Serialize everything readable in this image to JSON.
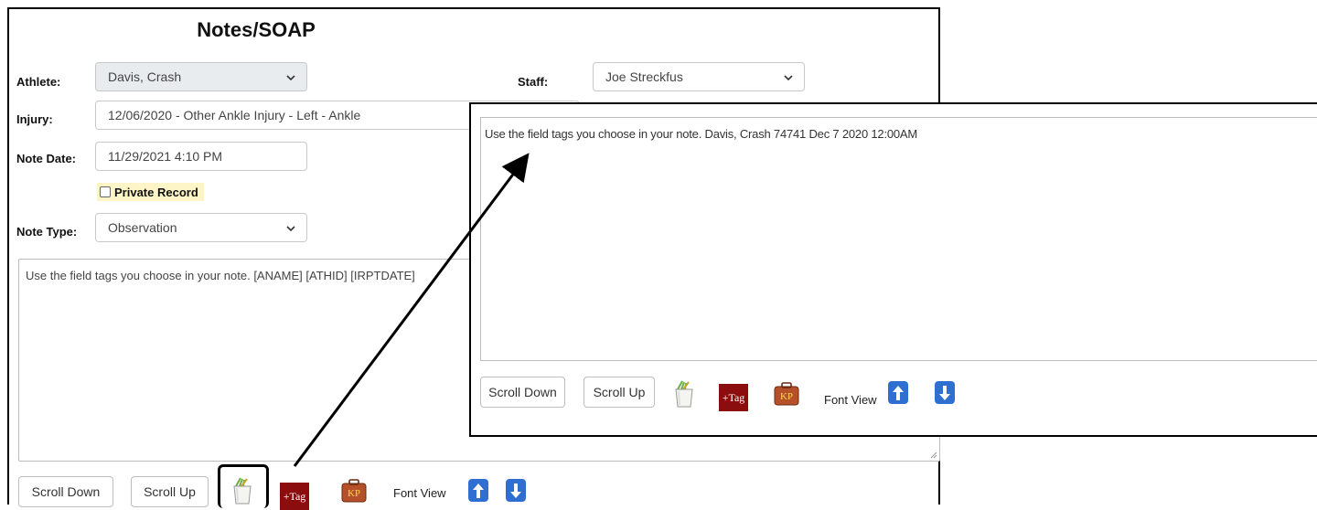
{
  "form": {
    "title": "Notes/SOAP",
    "athlete": {
      "label": "Athlete:",
      "value": "Davis, Crash"
    },
    "staff": {
      "label": "Staff:",
      "value": "Joe Streckfus"
    },
    "injury": {
      "label": "Injury:",
      "value": "12/06/2020 - Other Ankle Injury - Left - Ankle"
    },
    "note_date": {
      "label": "Note Date:",
      "value": "11/29/2021 4:10 PM"
    },
    "private_record": {
      "label": "Private Record",
      "checked": false
    },
    "note_type": {
      "label": "Note Type:",
      "value": "Observation"
    },
    "note_text": "Use the field tags you choose in your note.   [ANAME] [ATHID] [IRPTDATE]"
  },
  "toolbar": {
    "scroll_down": "Scroll Down",
    "scroll_up": "Scroll Up",
    "tag_label": "+Tag",
    "kp_icon": "KP",
    "font_view": "Font View"
  },
  "zoom": {
    "note_text": "Use the field tags you choose in your note.   Davis, Crash  74741 Dec  7 2020 12:00AM",
    "scroll_down": "Scroll Down",
    "scroll_up": "Scroll Up",
    "tag_label": "+Tag",
    "kp_icon": "KP",
    "font_view": "Font View"
  },
  "icons": {
    "cup": "pencil-cup-icon",
    "kp": "kp-briefcase-icon",
    "up": "arrow-up-icon",
    "down": "arrow-down-icon",
    "chevron": "chevron-down-icon"
  },
  "colors": {
    "tag_bg": "#8b0d0d",
    "arrow_bg": "#2f6fd1",
    "private_bg": "#fdf5c8",
    "disabled_bg": "#e9ecef"
  }
}
